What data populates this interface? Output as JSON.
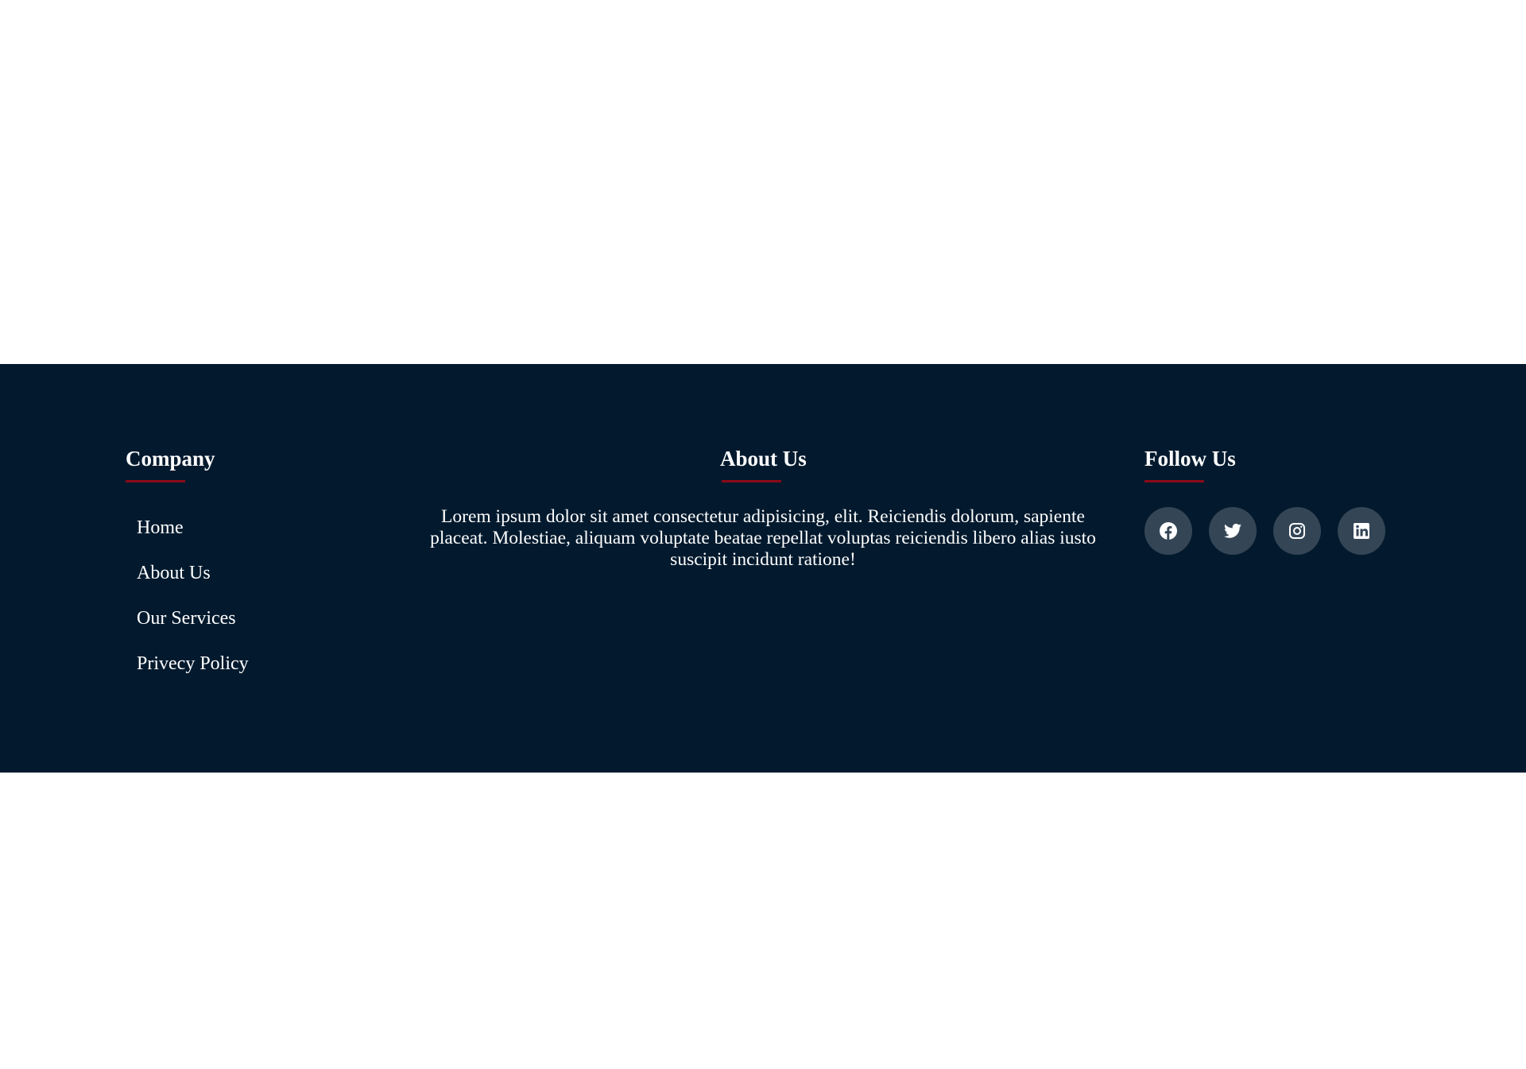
{
  "company": {
    "title": "Company",
    "links": [
      "Home",
      "About Us",
      "Our Services",
      "Privecy Policy"
    ]
  },
  "about": {
    "title": "About Us",
    "text": "Lorem ipsum dolor sit amet consectetur adipisicing, elit. Reiciendis dolorum, sapiente placeat. Molestiae, aliquam voluptate beatae repellat voluptas reiciendis libero alias iusto suscipit incidunt ratione!"
  },
  "follow": {
    "title": "Follow Us",
    "icons": [
      "facebook-icon",
      "twitter-icon",
      "instagram-icon",
      "linkedin-icon"
    ]
  },
  "colors": {
    "footer_bg": "#031a2e",
    "accent_underline": "#8b0a17",
    "social_button_bg": "#344656",
    "text": "#ffffff"
  }
}
